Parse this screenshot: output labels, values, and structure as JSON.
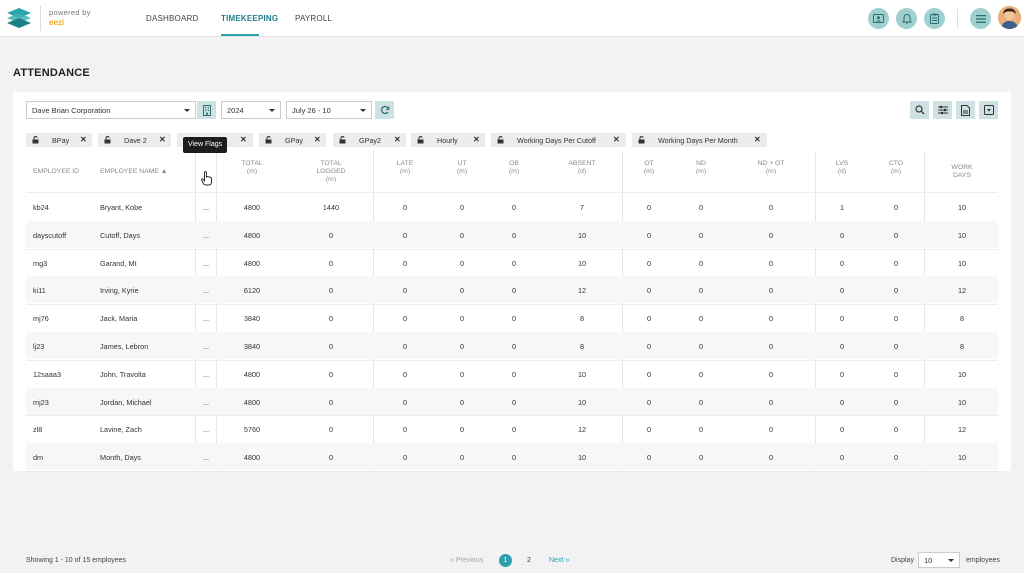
{
  "nav": {
    "powered_by": "powered by",
    "brand": "eezi",
    "links": [
      "DASHBOARD",
      "TIMEKEEPING",
      "PAYROLL"
    ],
    "active": "TIMEKEEPING"
  },
  "page": {
    "title": "ATTENDANCE"
  },
  "filters": {
    "company": "Dave Brian Corporation",
    "year": "2024",
    "period": "July 26 - 10"
  },
  "chips": [
    "BPay",
    "Dave 2",
    "",
    "GPay",
    "GPay2",
    "Hourly",
    "Working Days Per Cutoff",
    "Working Days Per Month"
  ],
  "tooltip": "View Flags",
  "table": {
    "headers": {
      "employee_id": "EMPLOYEE ID",
      "employee_name": "EMPLOYEE NAME ▲",
      "total": [
        "TOTAL",
        "(m)"
      ],
      "logged": [
        "TOTAL",
        "LOGGED",
        "(m)"
      ],
      "late": [
        "LATE",
        "(m)"
      ],
      "ut": [
        "UT",
        "(m)"
      ],
      "ob": [
        "OB",
        "(m)"
      ],
      "absent": [
        "ABSENT",
        "(d)"
      ],
      "ot": [
        "OT",
        "(m)"
      ],
      "nd": [
        "ND",
        "(m)"
      ],
      "ndot": [
        "ND + OT",
        "(m)"
      ],
      "lvs": [
        "LVS",
        "(d)"
      ],
      "cto": [
        "CTO",
        "(m)"
      ],
      "work": [
        "WORK",
        "DAYS"
      ]
    },
    "rows": [
      {
        "id": "kb24",
        "name": "Bryant, Kobe",
        "more": "...",
        "total": "4800",
        "logged": "1440",
        "late": "0",
        "ut": "0",
        "ob": "0",
        "absent": "7",
        "ot": "0",
        "nd": "0",
        "ndot": "0",
        "lvs": "1",
        "cto": "0",
        "work": "10"
      },
      {
        "id": "dayscutoff",
        "name": "Cutoff, Days",
        "more": "...",
        "total": "4800",
        "logged": "0",
        "late": "0",
        "ut": "0",
        "ob": "0",
        "absent": "10",
        "ot": "0",
        "nd": "0",
        "ndot": "0",
        "lvs": "0",
        "cto": "0",
        "work": "10"
      },
      {
        "id": "mg3",
        "name": "Garand, Mt",
        "more": "...",
        "total": "4800",
        "logged": "0",
        "late": "0",
        "ut": "0",
        "ob": "0",
        "absent": "10",
        "ot": "0",
        "nd": "0",
        "ndot": "0",
        "lvs": "0",
        "cto": "0",
        "work": "10"
      },
      {
        "id": "ki11",
        "name": "Irving, Kyrie",
        "more": "...",
        "total": "6120",
        "logged": "0",
        "late": "0",
        "ut": "0",
        "ob": "0",
        "absent": "12",
        "ot": "0",
        "nd": "0",
        "ndot": "0",
        "lvs": "0",
        "cto": "0",
        "work": "12"
      },
      {
        "id": "mj76",
        "name": "Jack, Maria",
        "more": "...",
        "total": "3840",
        "logged": "0",
        "late": "0",
        "ut": "0",
        "ob": "0",
        "absent": "8",
        "ot": "0",
        "nd": "0",
        "ndot": "0",
        "lvs": "0",
        "cto": "0",
        "work": "8"
      },
      {
        "id": "lj23",
        "name": "James, Lebron",
        "more": "...",
        "total": "3840",
        "logged": "0",
        "late": "0",
        "ut": "0",
        "ob": "0",
        "absent": "8",
        "ot": "0",
        "nd": "0",
        "ndot": "0",
        "lvs": "0",
        "cto": "0",
        "work": "8"
      },
      {
        "id": "12saaa3",
        "name": "John, Travolta",
        "more": "...",
        "total": "4800",
        "logged": "0",
        "late": "0",
        "ut": "0",
        "ob": "0",
        "absent": "10",
        "ot": "0",
        "nd": "0",
        "ndot": "0",
        "lvs": "0",
        "cto": "0",
        "work": "10"
      },
      {
        "id": "mj23",
        "name": "Jordan, Michael",
        "more": "...",
        "total": "4800",
        "logged": "0",
        "late": "0",
        "ut": "0",
        "ob": "0",
        "absent": "10",
        "ot": "0",
        "nd": "0",
        "ndot": "0",
        "lvs": "0",
        "cto": "0",
        "work": "10"
      },
      {
        "id": "zl8",
        "name": "Lavine, Zach",
        "more": "...",
        "total": "5760",
        "logged": "0",
        "late": "0",
        "ut": "0",
        "ob": "0",
        "absent": "12",
        "ot": "0",
        "nd": "0",
        "ndot": "0",
        "lvs": "0",
        "cto": "0",
        "work": "12"
      },
      {
        "id": "dm",
        "name": "Month, Days",
        "more": "...",
        "total": "4800",
        "logged": "0",
        "late": "0",
        "ut": "0",
        "ob": "0",
        "absent": "10",
        "ot": "0",
        "nd": "0",
        "ndot": "0",
        "lvs": "0",
        "cto": "0",
        "work": "10"
      }
    ]
  },
  "footer": {
    "showing": "Showing 1 - 10 of 15 employees",
    "previous": "Previous",
    "current_page": "1",
    "next_page": "2",
    "next": "Next",
    "display_label": "Display",
    "display_value": "10",
    "employees_label": "employees"
  },
  "colors": {
    "accent": "#2aa1ad",
    "brand": "#e6a72a",
    "icon_bg": "#9fd0cf"
  }
}
